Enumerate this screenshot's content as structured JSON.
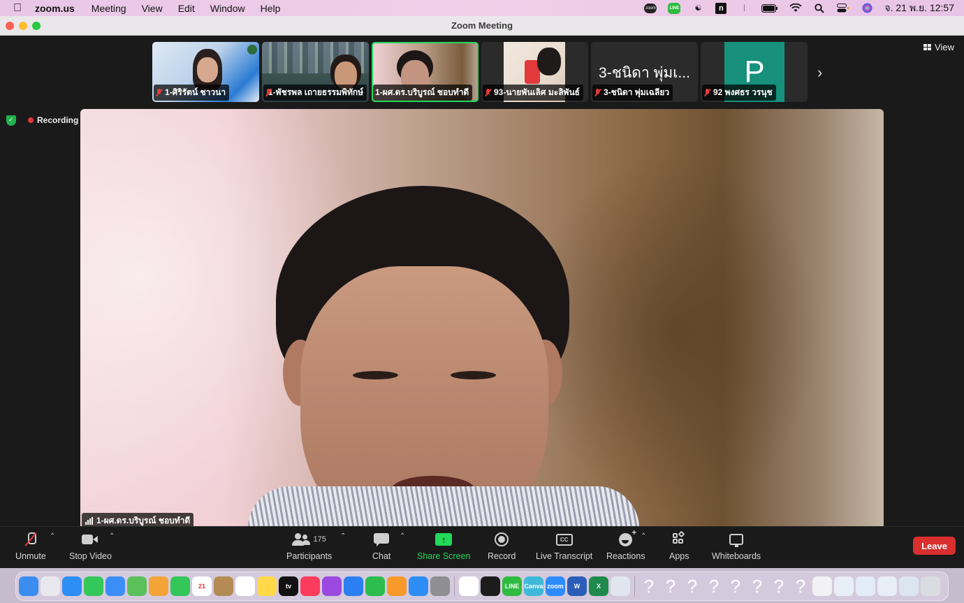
{
  "menubar": {
    "app_name": "zoom.us",
    "items": [
      "Meeting",
      "View",
      "Edit",
      "Window",
      "Help"
    ],
    "status_icons": [
      "zoom-status-icon",
      "line-status-icon",
      "w-app-icon",
      "n-app-icon",
      "bluetooth-icon",
      "battery-icon",
      "wifi-icon",
      "spotlight-icon",
      "control-center-icon",
      "siri-icon"
    ],
    "clock": "จ. 21 พ.ย.  12:57"
  },
  "window": {
    "title": "Zoom Meeting"
  },
  "thumbnails": [
    {
      "name": "1-ศิริรัตน์ ชาวนา",
      "muted": true,
      "active": false
    },
    {
      "name": "1-พัชรพล เถายธรรมพิทักษ์",
      "muted": true,
      "active": false
    },
    {
      "name": "1-ผศ.ดร.บริบูรณ์ ชอบทำดี",
      "muted": false,
      "active": true
    },
    {
      "name": "93-นายพันเลิศ มะลิพันธ์",
      "muted": true,
      "active": false
    },
    {
      "name": "3-ชนิดา พุ่มเฉลียว",
      "muted": true,
      "active": false,
      "display_text": "3-ชนิดา พุ่มเ..."
    },
    {
      "name": "92 พงศธร วรนุช",
      "muted": true,
      "active": false,
      "initial": "P",
      "tile_color": "#17907c"
    }
  ],
  "view_label": "View",
  "recording_label": "Recording",
  "speaker_name": "1-ผศ.ดร.บริบูรณ์ ชอบทำดี",
  "toolbar": {
    "unmute": "Unmute",
    "stop_video": "Stop Video",
    "participants": "Participants",
    "participants_count": "175",
    "chat": "Chat",
    "share_screen": "Share Screen",
    "record": "Record",
    "live_transcript": "Live Transcript",
    "reactions": "Reactions",
    "apps": "Apps",
    "whiteboards": "Whiteboards",
    "leave": "Leave"
  },
  "colors": {
    "active_speaker": "#23d959",
    "leave": "#d92f2f",
    "share": "#23d959"
  },
  "dock": {
    "apps": [
      {
        "name": "finder-icon",
        "color": "#3b8df0"
      },
      {
        "name": "launchpad-icon",
        "color": "#e8e8ee"
      },
      {
        "name": "safari-icon",
        "color": "#2d8ef5"
      },
      {
        "name": "messages-icon",
        "color": "#34c759"
      },
      {
        "name": "mail-icon",
        "color": "#3c8ef7"
      },
      {
        "name": "maps-icon",
        "color": "#5ac05a"
      },
      {
        "name": "photos-icon",
        "color": "#f4a338"
      },
      {
        "name": "facetime-icon",
        "color": "#33c659"
      },
      {
        "name": "calendar-icon",
        "color": "#ffffff",
        "label": "21"
      },
      {
        "name": "contacts-icon",
        "color": "#b48a55"
      },
      {
        "name": "reminders-icon",
        "color": "#ffffff"
      },
      {
        "name": "notes-icon",
        "color": "#ffd94a"
      },
      {
        "name": "tv-icon",
        "color": "#111111",
        "label": "tv"
      },
      {
        "name": "music-icon",
        "color": "#fb3c5c"
      },
      {
        "name": "podcasts-icon",
        "color": "#9b49e0"
      },
      {
        "name": "keynote-icon",
        "color": "#2a7ff2"
      },
      {
        "name": "numbers-icon",
        "color": "#2bbd4d"
      },
      {
        "name": "pages-icon",
        "color": "#f79a2a"
      },
      {
        "name": "app-store-icon",
        "color": "#2d8cf5"
      },
      {
        "name": "system-settings-icon",
        "color": "#8e8e93"
      }
    ],
    "apps2": [
      {
        "name": "chrome-icon",
        "color": "#ffffff"
      },
      {
        "name": "webex-icon",
        "color": "#1c1c1c"
      },
      {
        "name": "line-icon",
        "color": "#2fbb3f",
        "label": "LINE"
      },
      {
        "name": "canva-icon",
        "color": "#3fb9d9",
        "label": "Canva"
      },
      {
        "name": "zoom-icon",
        "color": "#2d8cff",
        "label": "zoom"
      },
      {
        "name": "word-icon",
        "color": "#2b5eb8",
        "label": "W"
      },
      {
        "name": "excel-icon",
        "color": "#1f8a4c",
        "label": "X"
      },
      {
        "name": "preview-icon",
        "color": "#dfe6ee"
      }
    ],
    "unknown_count": 8,
    "unknown_glyph": "?",
    "recent": [
      {
        "name": "document-icon",
        "color": "#f2f2f4"
      },
      {
        "name": "window-thumb-icon",
        "color": "#e8eef5"
      },
      {
        "name": "window-thumb-icon",
        "color": "#e2ecf8"
      },
      {
        "name": "window-thumb-icon",
        "color": "#e8eef5"
      },
      {
        "name": "window-thumb-icon",
        "color": "#dce6f0"
      },
      {
        "name": "trash-icon",
        "color": "#d9dde2"
      }
    ]
  }
}
